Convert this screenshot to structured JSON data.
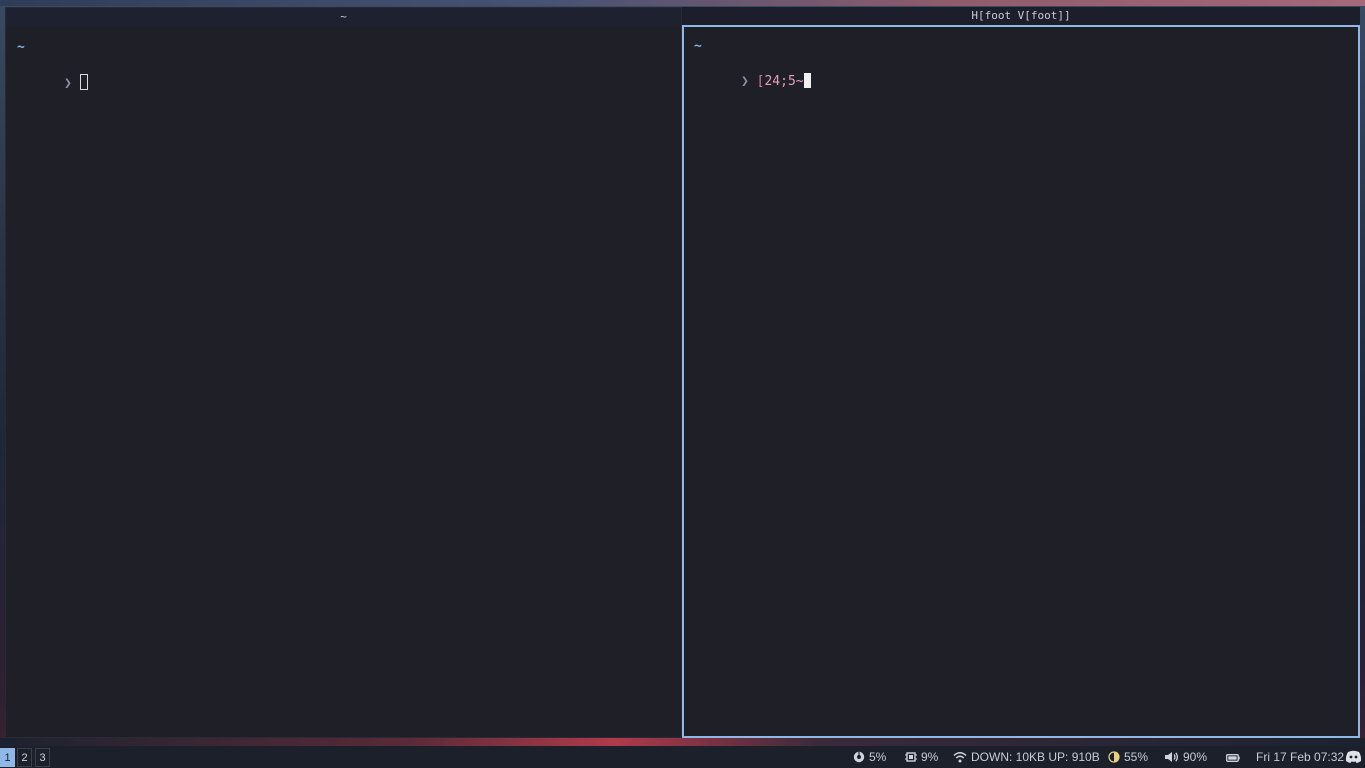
{
  "left_window": {
    "title": "~",
    "cwd_line": "~",
    "prompt_symbol": "❯"
  },
  "right_window": {
    "title": "H[foot V[foot]]",
    "cwd_line": "~",
    "prompt_symbol": "❯",
    "input_bracket": "[",
    "input_num": "24",
    "input_semi": ";",
    "input_tail": "5~"
  },
  "workspaces": [
    {
      "label": "1"
    },
    {
      "label": "2"
    },
    {
      "label": "3"
    }
  ],
  "status": {
    "cpu": "5%",
    "memory": "9%",
    "network": "DOWN: 10KB UP: 910B",
    "brightness": "55%",
    "volume": "90%",
    "datetime": "Fri 17 Feb 07:32"
  },
  "icons": {
    "cpu": "cpu-icon",
    "memory": "memory-icon",
    "network": "wifi-icon",
    "brightness": "brightness-icon",
    "volume": "volume-icon",
    "battery": "battery-icon",
    "tray": "discord-icon"
  },
  "colors": {
    "accent": "#8fb8e6",
    "terminal_bg": "#1f1f28",
    "bar_bg": "#1c202b"
  }
}
